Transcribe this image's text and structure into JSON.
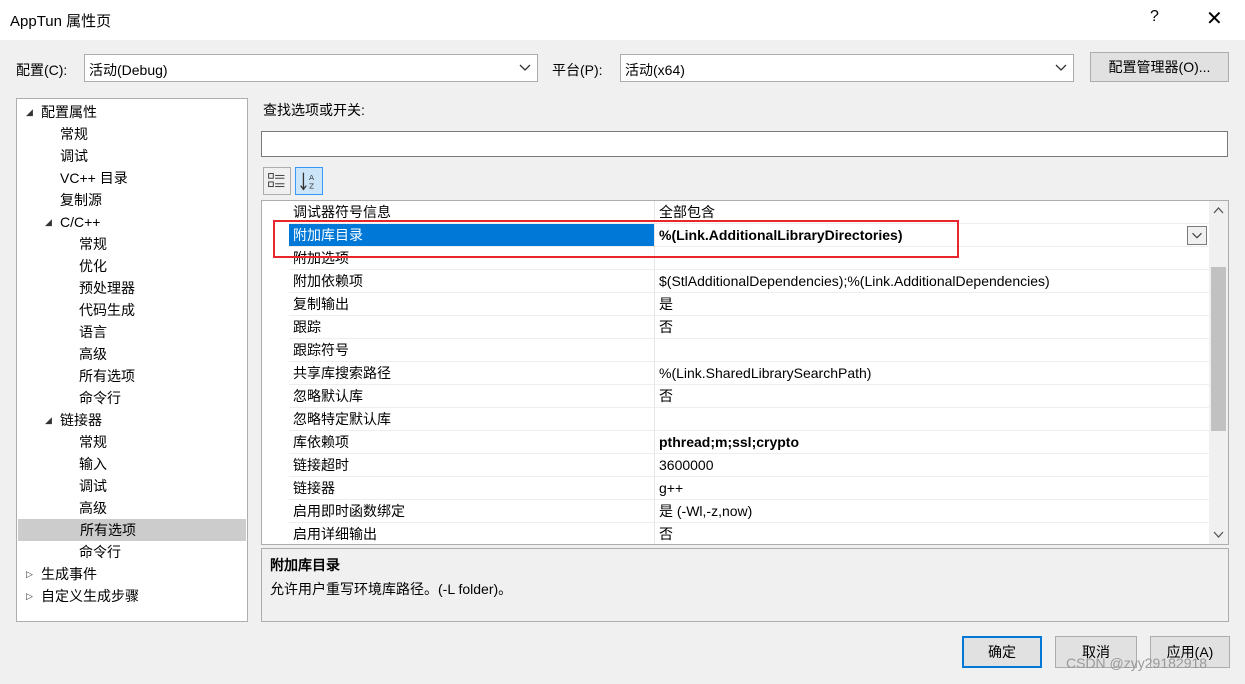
{
  "window": {
    "title": "AppTun 属性页",
    "help": "?",
    "close": "✕"
  },
  "config": {
    "label": "配置(C):",
    "value": "活动(Debug)"
  },
  "platform": {
    "label": "平台(P):",
    "value": "活动(x64)"
  },
  "config_manager_label": "配置管理器(O)...",
  "search": {
    "label": "查找选项或开关:",
    "value": ""
  },
  "tree": [
    {
      "label": "配置属性",
      "level": 0,
      "expander": "expanded"
    },
    {
      "label": "常规",
      "level": 1
    },
    {
      "label": "调试",
      "level": 1
    },
    {
      "label": "VC++ 目录",
      "level": 1
    },
    {
      "label": "复制源",
      "level": 1
    },
    {
      "label": "C/C++",
      "level": 1,
      "expander": "expanded"
    },
    {
      "label": "常规",
      "level": 2
    },
    {
      "label": "优化",
      "level": 2
    },
    {
      "label": "预处理器",
      "level": 2
    },
    {
      "label": "代码生成",
      "level": 2
    },
    {
      "label": "语言",
      "level": 2
    },
    {
      "label": "高级",
      "level": 2
    },
    {
      "label": "所有选项",
      "level": 2
    },
    {
      "label": "命令行",
      "level": 2
    },
    {
      "label": "链接器",
      "level": 1,
      "expander": "expanded"
    },
    {
      "label": "常规",
      "level": 2
    },
    {
      "label": "输入",
      "level": 2
    },
    {
      "label": "调试",
      "level": 2
    },
    {
      "label": "高级",
      "level": 2
    },
    {
      "label": "所有选项",
      "level": 2,
      "selected": true
    },
    {
      "label": "命令行",
      "level": 2
    },
    {
      "label": "生成事件",
      "level": 0,
      "expander": "collapsed"
    },
    {
      "label": "自定义生成步骤",
      "level": 0,
      "expander": "collapsed"
    }
  ],
  "properties": [
    {
      "name": "调试器符号信息",
      "value": "全部包含"
    },
    {
      "name": "附加库目录",
      "value": "%(Link.AdditionalLibraryDirectories)",
      "selected": true
    },
    {
      "name": "附加选项",
      "value": ""
    },
    {
      "name": "附加依赖项",
      "value": "$(StlAdditionalDependencies);%(Link.AdditionalDependencies)"
    },
    {
      "name": "复制输出",
      "value": "是"
    },
    {
      "name": "跟踪",
      "value": "否"
    },
    {
      "name": "跟踪符号",
      "value": ""
    },
    {
      "name": "共享库搜索路径",
      "value": "%(Link.SharedLibrarySearchPath)"
    },
    {
      "name": "忽略默认库",
      "value": "否"
    },
    {
      "name": "忽略特定默认库",
      "value": ""
    },
    {
      "name": "库依赖项",
      "value": "pthread;m;ssl;crypto",
      "bold": true
    },
    {
      "name": "链接超时",
      "value": "3600000"
    },
    {
      "name": "链接器",
      "value": "g++"
    },
    {
      "name": "启用即时函数绑定",
      "value": "是 (-Wl,-z,now)"
    },
    {
      "name": "启用详细输出",
      "value": "否"
    }
  ],
  "description": {
    "title": "附加库目录",
    "text": "允许用户重写环境库路径。(-L folder)。"
  },
  "buttons": {
    "ok": "确定",
    "cancel": "取消",
    "apply": "应用(A)"
  },
  "watermark": "CSDN @zyy29182918"
}
